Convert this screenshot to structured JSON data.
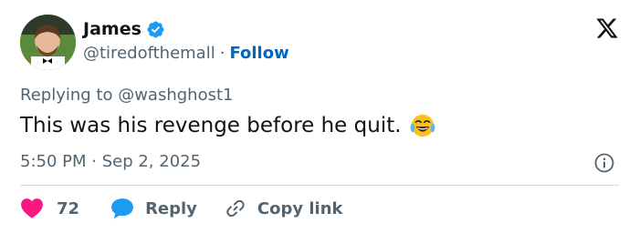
{
  "user": {
    "name": "James",
    "handle": "@tiredofthemall",
    "separator": "·",
    "follow_label": "Follow"
  },
  "tweet": {
    "replying_to": "Replying to @washghost1",
    "text": "This was his revenge before he quit.",
    "timestamp": "5:50 PM · Sep 2, 2025"
  },
  "actions": {
    "like_count": "72",
    "reply_label": "Reply",
    "copy_link_label": "Copy link"
  },
  "colors": {
    "text": "#0f1419",
    "secondary": "#536471",
    "link": "#0066c0",
    "verified": "#1d9bf0",
    "heart": "#f91880",
    "divider": "#cfd9de"
  },
  "icons": [
    "avatar",
    "verified-badge-icon",
    "x-logo-icon",
    "face-with-tears-of-joy-emoji",
    "info-icon",
    "heart-icon",
    "reply-bubble-icon",
    "link-icon"
  ]
}
